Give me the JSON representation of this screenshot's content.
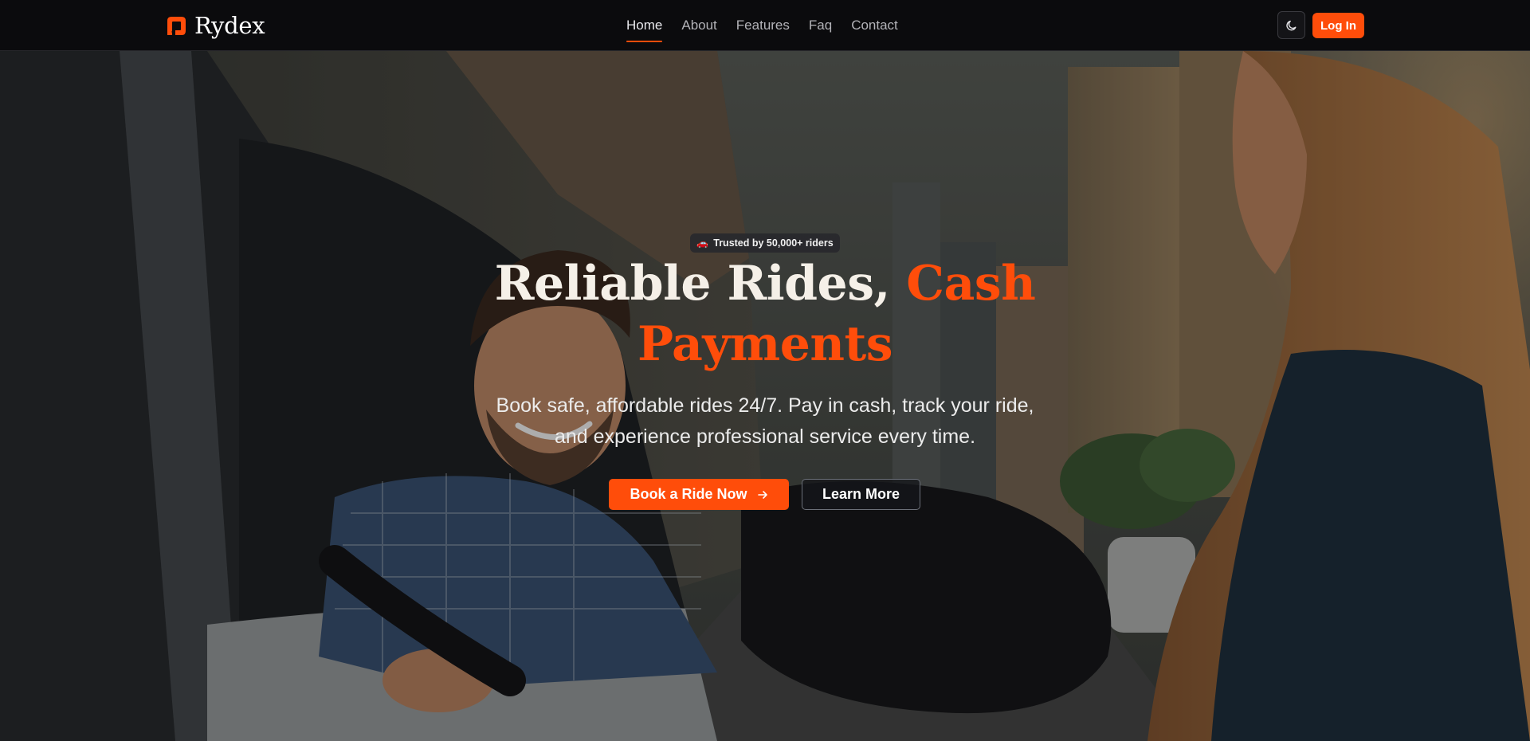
{
  "brand": {
    "name": "Rydex",
    "accent": "#ff4d0a"
  },
  "nav": {
    "links": [
      {
        "label": "Home",
        "active": true
      },
      {
        "label": "About",
        "active": false
      },
      {
        "label": "Features",
        "active": false
      },
      {
        "label": "Faq",
        "active": false
      },
      {
        "label": "Contact",
        "active": false
      }
    ],
    "theme_toggle_icon": "moon-icon",
    "login_label": "Log In"
  },
  "hero": {
    "badge_icon": "🚗",
    "badge_text": "Trusted by 50,000+ riders",
    "headline_white": "Reliable Rides, ",
    "headline_accent": "Cash Payments",
    "subtext": "Book safe, affordable rides 24/7. Pay in cash, track your ride, and experience professional service every time.",
    "primary_cta": "Book a Ride Now",
    "primary_cta_icon": "arrow-right-icon",
    "secondary_cta": "Learn More"
  }
}
